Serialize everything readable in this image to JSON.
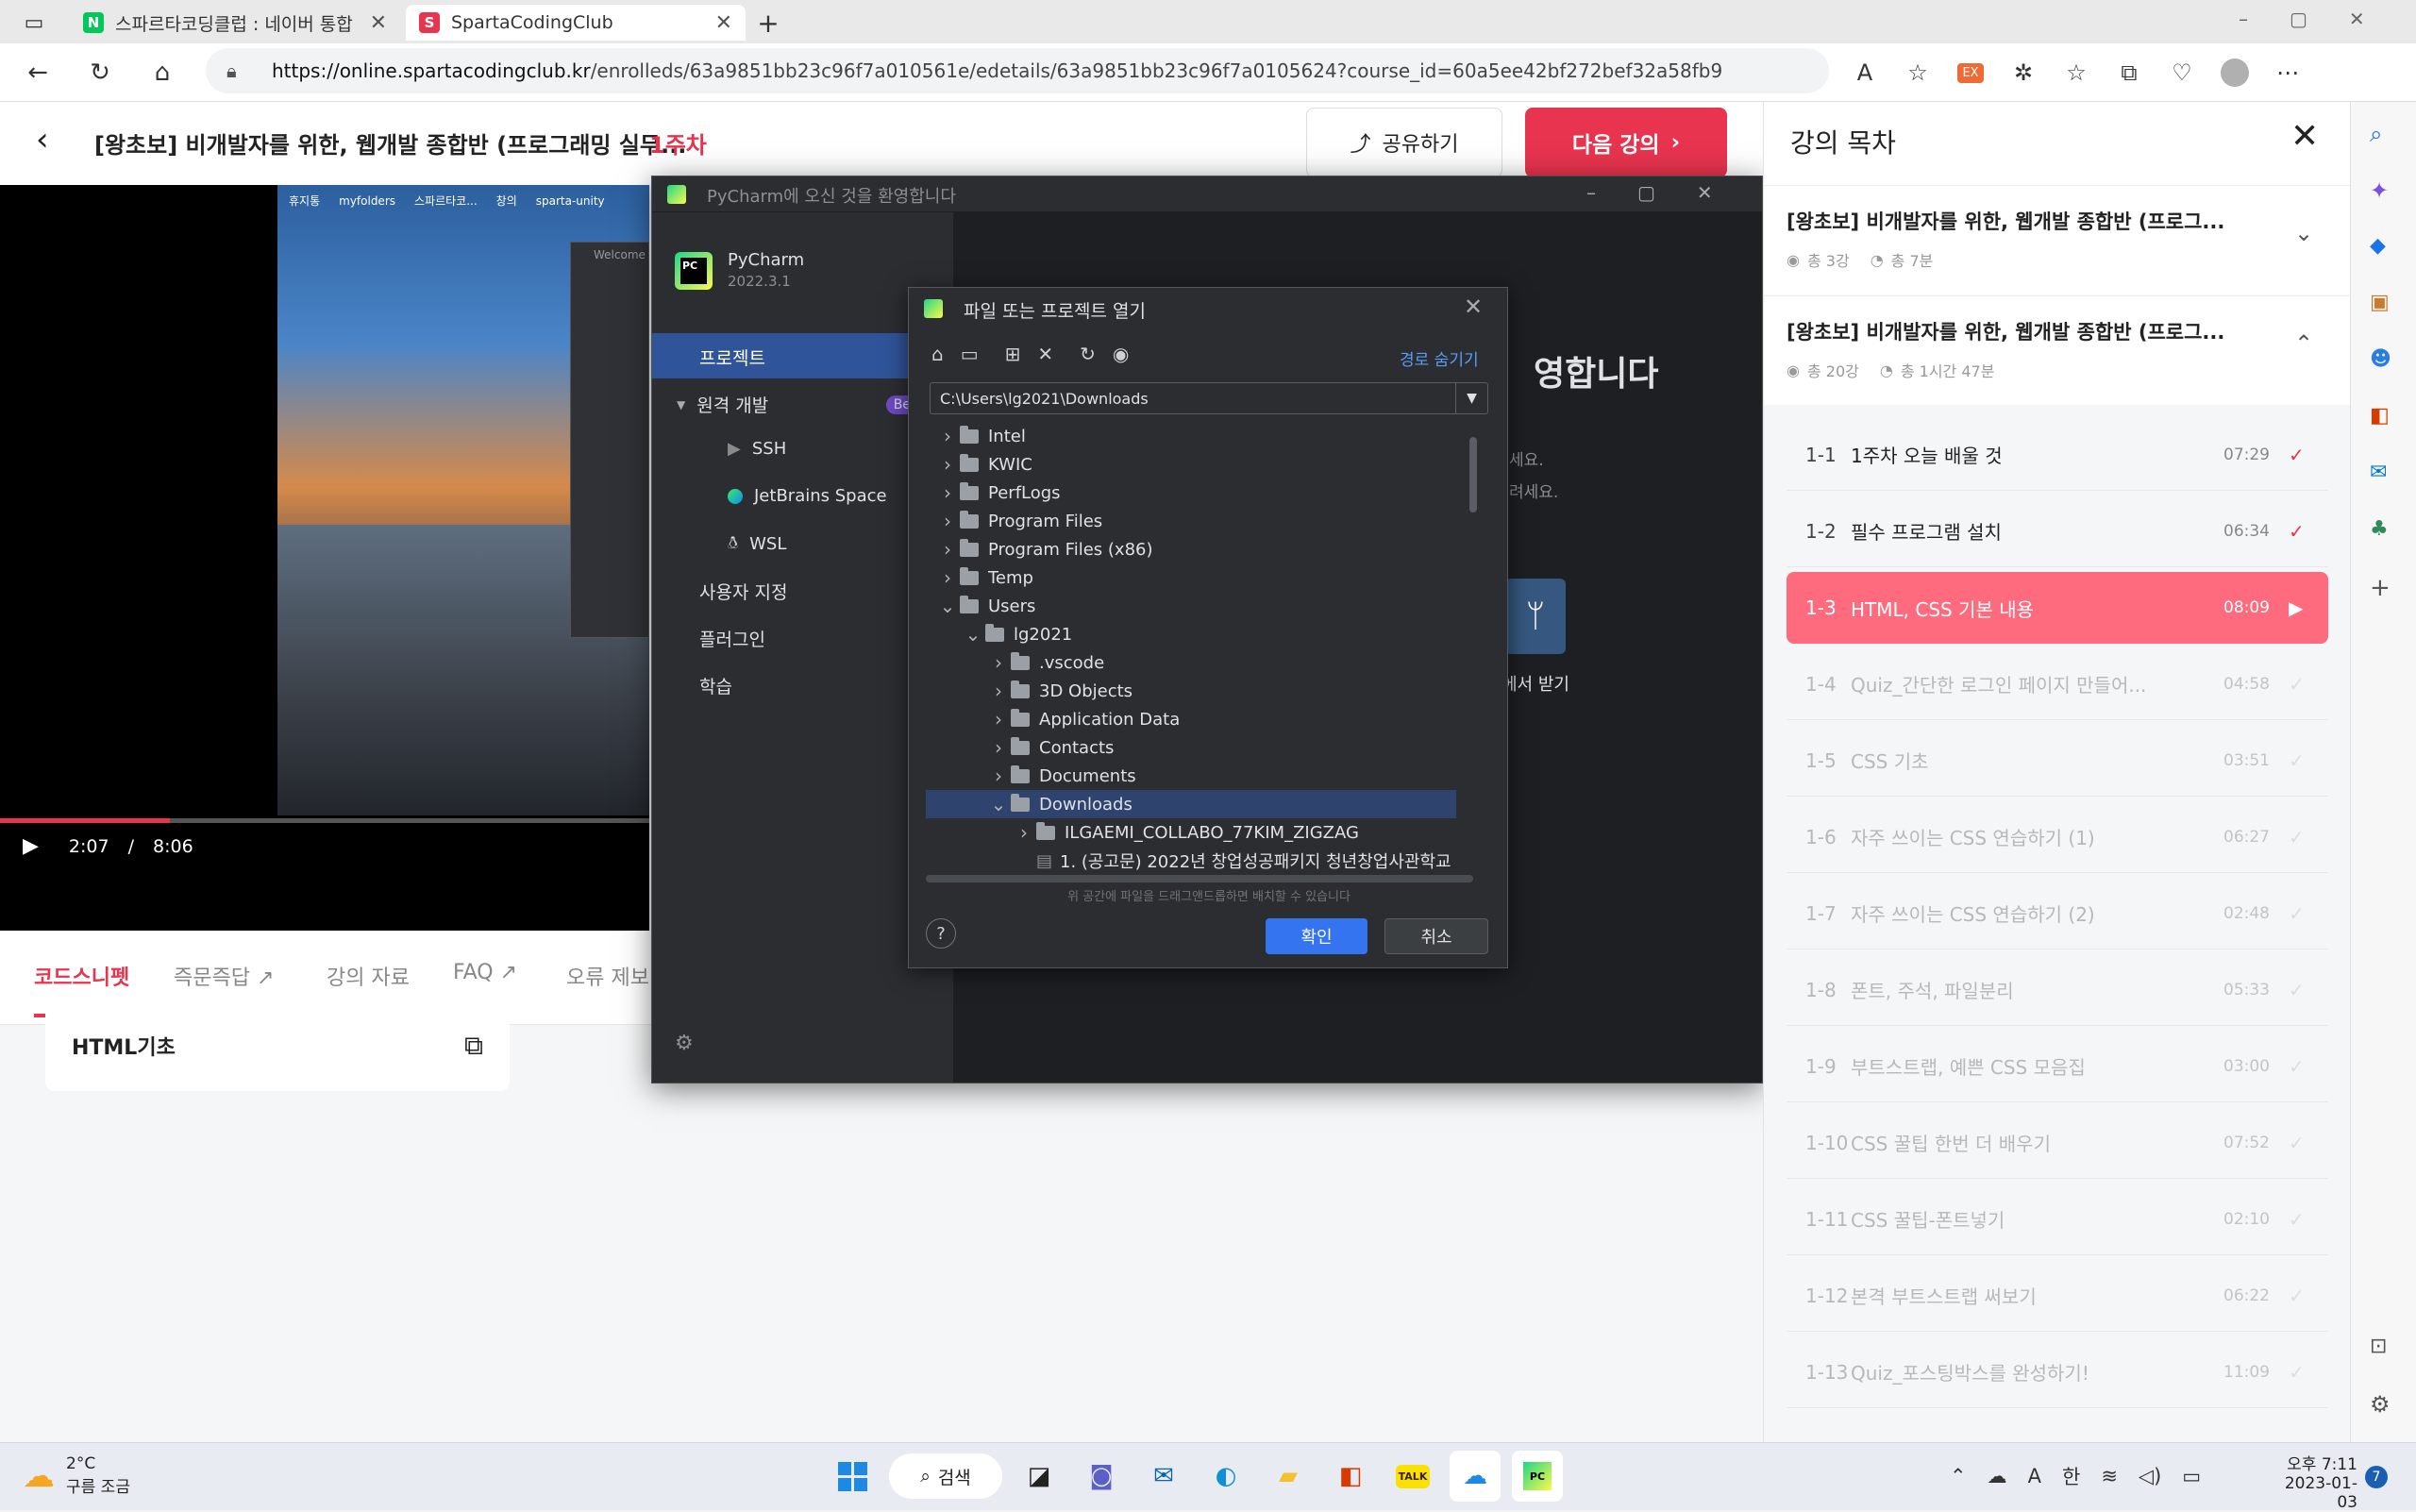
{
  "browser": {
    "tabs": [
      {
        "title": "스파르타코딩클럽 : 네이버 통합",
        "favicon": "N",
        "favicon_color": "#03c75a"
      },
      {
        "title": "SpartaCodingClub",
        "favicon": "S",
        "favicon_color": "#e8344e"
      }
    ],
    "url_host": "https://online.spartacodingclub.kr",
    "url_path": "/enrolleds/63a9851bb23c96f7a010561e/edetails/63a9851bb23c96f7a0105624?course_id=60a5ee42bf272bef32a58fb9"
  },
  "header": {
    "title": "[왕초보] 비개발자를 위한, 웹개발 종합반 (프로그래밍 실무...",
    "week": "1주차",
    "share_label": "공유하기",
    "next_label": "다음 강의",
    "accent": "#e8344e"
  },
  "video": {
    "current": "2:07",
    "separator": "/",
    "total": "8:06",
    "progress": 0.262,
    "desktop_icons": [
      "휴지통",
      "myfolders",
      "스파르타코...",
      "창의",
      "sparta-unity"
    ],
    "welcome": "Welcome"
  },
  "content_tabs": [
    "코드스니펫",
    "즉문즉답",
    "강의 자료",
    "FAQ",
    "오류 제보"
  ],
  "snippet_card": {
    "label": "HTML기초"
  },
  "pycharm": {
    "window_title": "PyCharm에 오신 것을 환영합니다",
    "product": "PyCharm",
    "version": "2022.3.1",
    "nav": [
      {
        "label": "프로젝트"
      },
      {
        "label": "원격 개발",
        "badge": "Beta"
      },
      {
        "label": "SSH"
      },
      {
        "label": "JetBrains Space"
      },
      {
        "label": "WSL"
      },
      {
        "label": "사용자 지정"
      },
      {
        "label": "플러그인"
      },
      {
        "label": "학습"
      }
    ],
    "welcome_heading": "영합니다",
    "welcome_line1": "세요.",
    "welcome_line2": "려세요.",
    "vcs_label": "에서 받기"
  },
  "dialog": {
    "title": "파일 또는 프로젝트 열기",
    "hide_path": "경로 숨기기",
    "path": "C:\\Users\\lg2021\\Downloads",
    "tree": [
      {
        "label": "Intel",
        "level": 0,
        "open": false
      },
      {
        "label": "KWIC",
        "level": 0,
        "open": false
      },
      {
        "label": "PerfLogs",
        "level": 0,
        "open": false
      },
      {
        "label": "Program Files",
        "level": 0,
        "open": false
      },
      {
        "label": "Program Files (x86)",
        "level": 0,
        "open": false
      },
      {
        "label": "Temp",
        "level": 0,
        "open": false
      },
      {
        "label": "Users",
        "level": 0,
        "open": true
      },
      {
        "label": "lg2021",
        "level": 1,
        "open": true
      },
      {
        "label": ".vscode",
        "level": 2,
        "open": false
      },
      {
        "label": "3D Objects",
        "level": 2,
        "open": false
      },
      {
        "label": "Application Data",
        "level": 2,
        "open": false
      },
      {
        "label": "Contacts",
        "level": 2,
        "open": false
      },
      {
        "label": "Documents",
        "level": 2,
        "open": false
      },
      {
        "label": "Downloads",
        "level": 2,
        "open": true,
        "selected": true
      },
      {
        "label": "ILGAEMI_COLLABO_77KIM_ZIGZAG",
        "level": 3,
        "open": false
      },
      {
        "label": "1. (공고문) 2022년 창업성공패키지 청년창업사관학교",
        "level": 3,
        "file": true
      }
    ],
    "drag_hint": "위 공간에 파일을 드래그앤드롭하면 배치할 수 있습니다",
    "ok_label": "확인",
    "cancel_label": "취소",
    "help_label": "?"
  },
  "toc": {
    "title": "강의 목차",
    "sections": [
      {
        "title": "[왕초보] 비개발자를 위한, 웹개발 종합반 (프로그...",
        "count": "총 3강",
        "time": "총 7분",
        "expanded": false
      },
      {
        "title": "[왕초보] 비개발자를 위한, 웹개발 종합반 (프로그...",
        "count": "총 20강",
        "time": "총 1시간 47분",
        "expanded": true
      }
    ],
    "lessons": [
      {
        "num": "1-1",
        "title": "1주차 오늘 배울 것",
        "duration": "07:29",
        "state": "done"
      },
      {
        "num": "1-2",
        "title": "필수 프로그램 설치",
        "duration": "06:34",
        "state": "done"
      },
      {
        "num": "1-3",
        "title": "HTML, CSS 기본 내용",
        "duration": "08:09",
        "state": "active"
      },
      {
        "num": "1-4",
        "title": "Quiz_간단한 로그인 페이지 만들어...",
        "duration": "04:58",
        "state": "todo"
      },
      {
        "num": "1-5",
        "title": "CSS 기초",
        "duration": "03:51",
        "state": "todo"
      },
      {
        "num": "1-6",
        "title": "자주 쓰이는 CSS 연습하기 (1)",
        "duration": "06:27",
        "state": "todo"
      },
      {
        "num": "1-7",
        "title": "자주 쓰이는 CSS 연습하기 (2)",
        "duration": "02:48",
        "state": "todo"
      },
      {
        "num": "1-8",
        "title": "폰트, 주석, 파일분리",
        "duration": "05:33",
        "state": "todo"
      },
      {
        "num": "1-9",
        "title": "부트스트랩, 예쁜 CSS 모음집",
        "duration": "03:00",
        "state": "todo"
      },
      {
        "num": "1-10",
        "title": "CSS 꿀팁 한번 더 배우기",
        "duration": "07:52",
        "state": "todo"
      },
      {
        "num": "1-11",
        "title": "CSS 꿀팁-폰트넣기",
        "duration": "02:10",
        "state": "todo"
      },
      {
        "num": "1-12",
        "title": "본격 부트스트랩 써보기",
        "duration": "06:22",
        "state": "todo"
      },
      {
        "num": "1-13",
        "title": "Quiz_포스팅박스를 완성하기!",
        "duration": "11:09",
        "state": "todo"
      }
    ]
  },
  "taskbar": {
    "weather_temp": "2°C",
    "weather_desc": "구름 조금",
    "search_label": "검색",
    "tray_a": "A",
    "tray_ime": "한",
    "time": "오후 7:11",
    "date": "2023-01-03",
    "notif_count": "7"
  }
}
